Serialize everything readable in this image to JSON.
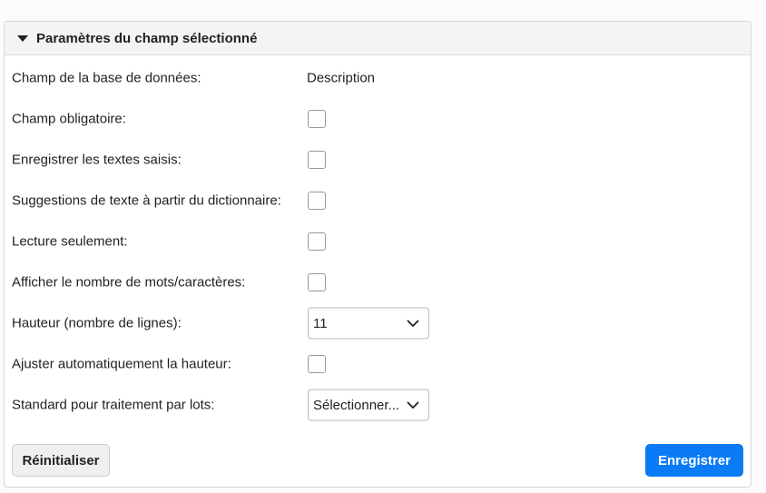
{
  "panel": {
    "title": "Paramètres du champ sélectionné"
  },
  "fields": {
    "db_field": {
      "label": "Champ de la base de données:",
      "value": "Description"
    },
    "required": {
      "label": "Champ obligatoire:"
    },
    "save_texts": {
      "label": "Enregistrer les textes saisis:"
    },
    "dictionary_suggestions": {
      "label": "Suggestions de texte à partir du dictionnaire:"
    },
    "read_only": {
      "label": "Lecture seulement:"
    },
    "show_count": {
      "label": "Afficher le nombre de mots/caractères:"
    },
    "height": {
      "label": "Hauteur (nombre de lignes):",
      "value": "11"
    },
    "auto_height": {
      "label": "Ajuster automatiquement la hauteur:"
    },
    "batch_default": {
      "label": "Standard pour traitement par lots:",
      "value": "Sélectionner..."
    }
  },
  "buttons": {
    "reset": "Réinitialiser",
    "save": "Enregistrer"
  },
  "colors": {
    "accent": "#0a7bf5"
  }
}
